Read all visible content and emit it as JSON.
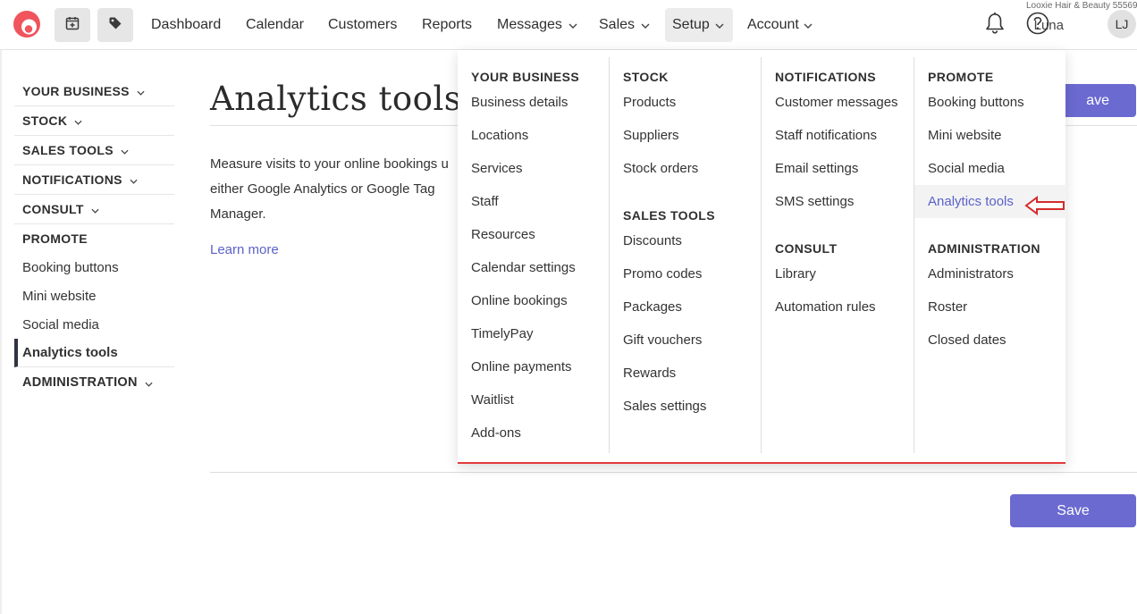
{
  "business_name": "Looxie Hair & Beauty 55569",
  "nav": {
    "items": [
      {
        "label": "Dashboard",
        "has_menu": false
      },
      {
        "label": "Calendar",
        "has_menu": false
      },
      {
        "label": "Customers",
        "has_menu": false
      },
      {
        "label": "Reports",
        "has_menu": false
      },
      {
        "label": "Messages",
        "has_menu": true
      },
      {
        "label": "Sales",
        "has_menu": true
      },
      {
        "label": "Setup",
        "has_menu": true,
        "active": true
      },
      {
        "label": "Account",
        "has_menu": true
      }
    ],
    "user_name": "Luna",
    "user_initials": "LJ",
    "icons": [
      "timely-logo-icon",
      "calendar-add-icon",
      "tag-icon",
      "bell-icon",
      "help-icon"
    ]
  },
  "sidebar": {
    "sections": [
      {
        "label": "YOUR BUSINESS",
        "expanded": false
      },
      {
        "label": "STOCK",
        "expanded": false
      },
      {
        "label": "SALES TOOLS",
        "expanded": false
      },
      {
        "label": "NOTIFICATIONS",
        "expanded": false
      },
      {
        "label": "CONSULT",
        "expanded": false
      },
      {
        "label": "PROMOTE",
        "expanded": true
      },
      {
        "label": "ADMINISTRATION",
        "expanded": false
      }
    ],
    "promote_items": [
      "Booking buttons",
      "Mini website",
      "Social media",
      "Analytics tools"
    ],
    "active_item": "Analytics tools"
  },
  "main": {
    "title": "Analytics tools",
    "description": "Measure visits to your online bookings u either Google Analytics or Google Tag Manager.",
    "description_lines": [
      "Measure visits to your online bookings u",
      "either Google Analytics or Google Tag",
      "Manager."
    ],
    "learn_more": "Learn more",
    "save_top": "ave",
    "save_bottom": "Save"
  },
  "dropdown": {
    "col1": {
      "heading": "YOUR BUSINESS",
      "items": [
        "Business details",
        "Locations",
        "Services",
        "Staff",
        "Resources",
        "Calendar settings",
        "Online bookings",
        "TimelyPay",
        "Online payments",
        "Waitlist",
        "Add-ons"
      ]
    },
    "col2": {
      "heading1": "STOCK",
      "items1": [
        "Products",
        "Suppliers",
        "Stock orders"
      ],
      "heading2": "SALES TOOLS",
      "items2": [
        "Discounts",
        "Promo codes",
        "Packages",
        "Gift vouchers",
        "Rewards",
        "Sales settings"
      ]
    },
    "col3": {
      "heading1": "NOTIFICATIONS",
      "items1": [
        "Customer messages",
        "Staff notifications",
        "Email settings",
        "SMS settings"
      ],
      "heading2": "CONSULT",
      "items2": [
        "Library",
        "Automation rules"
      ]
    },
    "col4": {
      "heading1": "PROMOTE",
      "items1": [
        "Booking buttons",
        "Mini website",
        "Social media",
        "Analytics tools"
      ],
      "heading2": "ADMINISTRATION",
      "items2": [
        "Administrators",
        "Roster",
        "Closed dates"
      ]
    },
    "selected": "Analytics tools"
  },
  "colors": {
    "accent": "#6b6ad1",
    "link": "#5b62c8",
    "brand_red": "#f0545c",
    "annotation_arrow": "#d42b2b",
    "dropdown_border": "#e23b3b"
  }
}
